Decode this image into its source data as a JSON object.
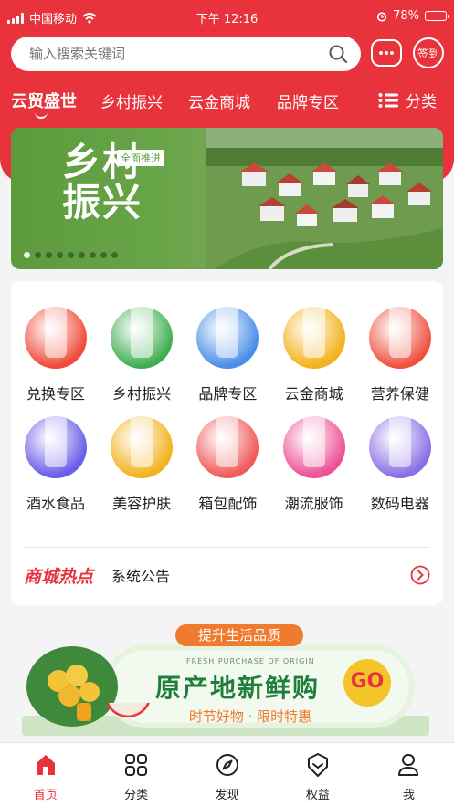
{
  "status_bar": {
    "carrier": "中国移动",
    "time": "下午 12:16",
    "battery": "78%",
    "battery_level": 0.78
  },
  "search": {
    "placeholder": "输入搜索关键词"
  },
  "header": {
    "sign_label": "签到",
    "message_icon": "message-dots-icon"
  },
  "tabs": [
    {
      "label": "云贸盛世",
      "active": true
    },
    {
      "label": "乡村振兴"
    },
    {
      "label": "云金商城"
    },
    {
      "label": "品牌专区"
    }
  ],
  "category_button": "分类",
  "banner": {
    "slogan": "乡村振兴",
    "tag": "全面推进",
    "dots": 9,
    "active_dot": 0
  },
  "grid": [
    {
      "label": "兑换专区",
      "color": "#f04a3a"
    },
    {
      "label": "乡村振兴",
      "color": "#3fae52"
    },
    {
      "label": "品牌专区",
      "color": "#4a8ee8"
    },
    {
      "label": "云金商城",
      "color": "#f2b21c"
    },
    {
      "label": "营养保健",
      "color": "#f0513f"
    },
    {
      "label": "酒水食品",
      "color": "#6a5ce8"
    },
    {
      "label": "美容护肤",
      "color": "#f2b21c"
    },
    {
      "label": "箱包配饰",
      "color": "#f05a5a"
    },
    {
      "label": "潮流服饰",
      "color": "#ee5096"
    },
    {
      "label": "数码电器",
      "color": "#8a70e6"
    }
  ],
  "notice": {
    "logo": "商城热点",
    "text": "系统公告"
  },
  "promo": {
    "ribbon": "提升生活品质",
    "subtitle_en": "FRESH PURCHASE OF ORIGIN",
    "title": "原产地新鲜购",
    "go": "GO",
    "bottom": "时节好物 · 限时特惠"
  },
  "bottom_nav": [
    {
      "label": "首页",
      "active": true
    },
    {
      "label": "分类"
    },
    {
      "label": "发现"
    },
    {
      "label": "权益"
    },
    {
      "label": "我"
    }
  ]
}
